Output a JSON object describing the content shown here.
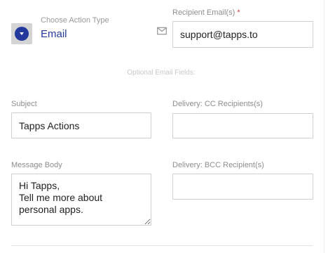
{
  "action_type": {
    "label": "Choose Action Type",
    "value": "Email",
    "toggle_icon": "chevron-down-icon"
  },
  "recipient": {
    "label": "Recipient Email(s)",
    "required_mark": "*",
    "value": "support@tapps.to",
    "icon": "mail-icon"
  },
  "optional_section_label": "Optional Email Fields:",
  "subject": {
    "label": "Subject",
    "value": "Tapps Actions"
  },
  "cc": {
    "label": "Delivery: CC Recipients(s)",
    "value": ""
  },
  "message_body": {
    "label": "Message Body",
    "value": "Hi Tapps,\nTell me more about\npersonal apps."
  },
  "bcc": {
    "label": "Delivery: BCC Recipient(s)",
    "value": ""
  },
  "colors": {
    "accent": "#233a9c",
    "label": "#8e8e8e",
    "border": "#cfcfcf",
    "required": "#c53b3b"
  }
}
